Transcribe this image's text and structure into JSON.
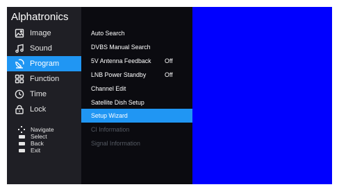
{
  "brand": "Alphatronics",
  "nav": [
    {
      "label": "Image",
      "icon": "image-icon"
    },
    {
      "label": "Sound",
      "icon": "music-note-icon"
    },
    {
      "label": "Program",
      "icon": "satellite-icon"
    },
    {
      "label": "Function",
      "icon": "grid-icon"
    },
    {
      "label": "Time",
      "icon": "clock-icon"
    },
    {
      "label": "Lock",
      "icon": "lock-icon"
    }
  ],
  "nav_active": "Program",
  "help": [
    {
      "key": "navigate-key-icon",
      "label": "Navigate"
    },
    {
      "key": "ok-key-icon",
      "label": "Select"
    },
    {
      "key": "back-key-icon",
      "label": "Back"
    },
    {
      "key": "exit-key-icon",
      "label": "Exit"
    }
  ],
  "menu": [
    {
      "label": "Auto Search",
      "value": ""
    },
    {
      "label": "DVBS Manual Search",
      "value": ""
    },
    {
      "label": "5V Antenna Feedback",
      "value": "Off"
    },
    {
      "label": "LNB Power Standby",
      "value": "Off"
    },
    {
      "label": "Channel Edit",
      "value": ""
    },
    {
      "label": "Satellite Dish Setup",
      "value": ""
    },
    {
      "label": "Setup Wizard",
      "value": "",
      "state": "selected"
    },
    {
      "label": "CI Information",
      "value": "",
      "state": "disabled"
    },
    {
      "label": "Signal Information",
      "value": "",
      "state": "disabled"
    }
  ],
  "colors": {
    "accent": "#2096f3",
    "preview": "#0000ff",
    "sidebar": "#1f1f25",
    "submenu": "#0b0b10"
  }
}
